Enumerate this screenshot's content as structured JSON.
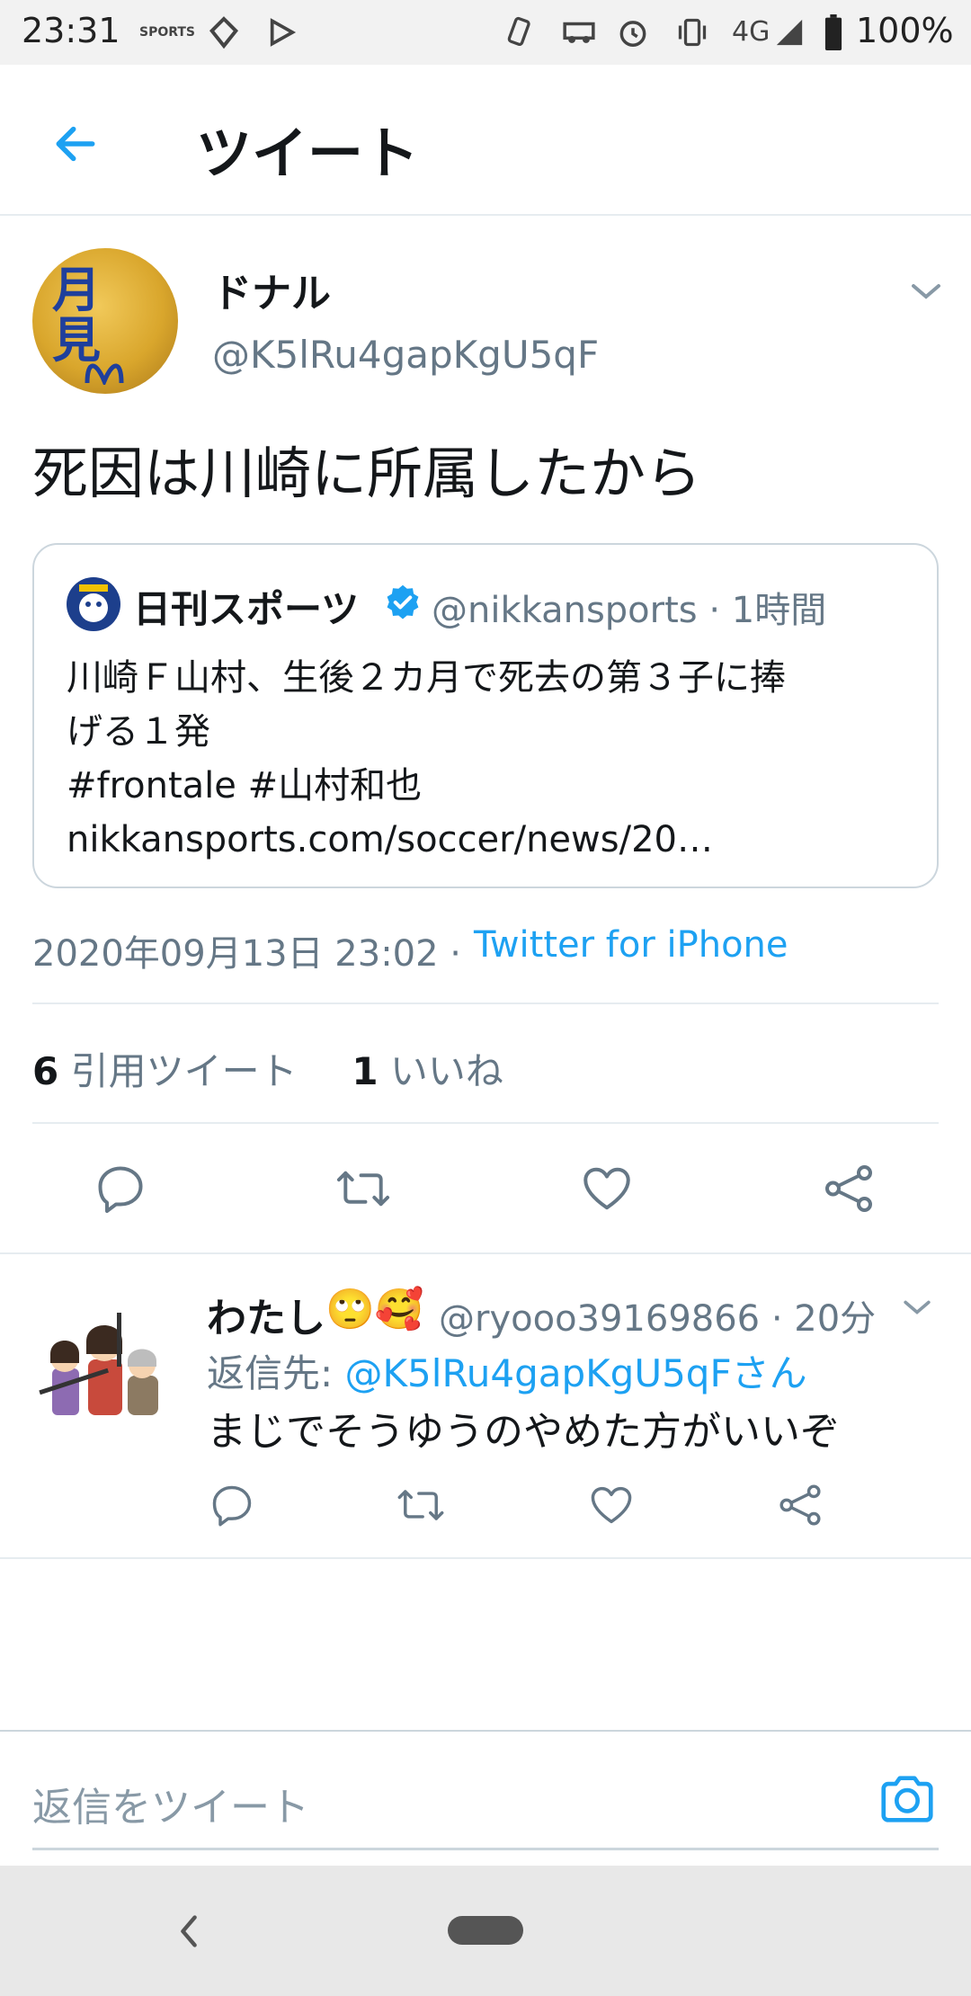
{
  "status_bar": {
    "time": "23:31",
    "app_icon_label": "SPORTS",
    "network": "4G",
    "battery": "100%"
  },
  "header": {
    "title": "ツイート"
  },
  "tweet": {
    "avatar_text": "月見",
    "author_name": "ドナル",
    "author_handle": "@K5lRu4gapKgU5qF",
    "text": "死因は川崎に所属したから",
    "quote": {
      "name": "日刊スポーツ",
      "handle_time": "@nikkansports · 1時間",
      "text_line1": "川崎Ｆ山村、生後２カ月で死去の第３子に捧",
      "text_line2": "げる１発",
      "text_line3": "#frontale #山村和也",
      "text_line4": "nikkansports.com/soccer/news/20…"
    },
    "date": "2020年09月13日 23:02 · ",
    "source": "Twitter for iPhone",
    "quote_count": "6",
    "quote_label": "引用ツイート",
    "like_count": "1",
    "like_label": "いいね"
  },
  "reply": {
    "name": "わたし",
    "emoji": "🙄🥰",
    "handle_time": "@ryooo39169866 · 20分",
    "reply_to_label": "返信先: ",
    "reply_to_user": "@K5lRu4gapKgU5qFさん",
    "text": "まじでそうゆうのやめた方がいいぞ"
  },
  "compose": {
    "placeholder": "返信をツイート"
  },
  "colors": {
    "accent": "#1da1f2",
    "secondary_text": "#657786",
    "divider": "#e6ecf0"
  }
}
